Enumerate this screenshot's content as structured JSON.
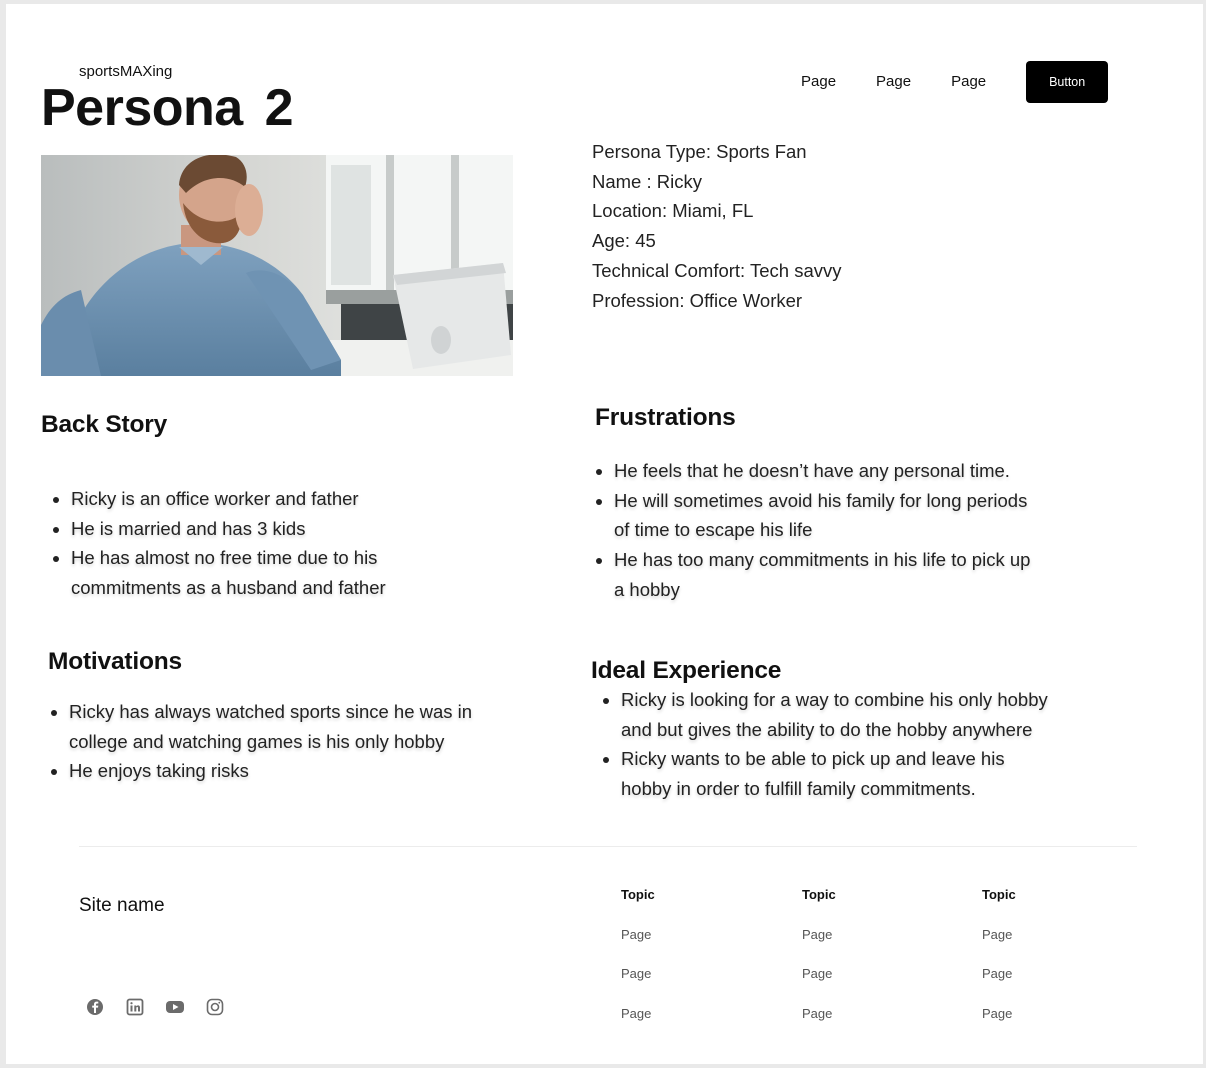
{
  "header": {
    "brand": "sportsMAXing",
    "title": "Persona 2",
    "nav": [
      "Page",
      "Page",
      "Page"
    ],
    "button_label": "Button"
  },
  "persona_info": [
    "Persona Type: Sports Fan",
    "Name : Ricky",
    "Location: Miami, FL",
    "Age: 45",
    "Technical Comfort: Tech savvy",
    "Profession: Office Worker"
  ],
  "back_story": {
    "heading": "Back Story",
    "items": [
      "Ricky is an office worker and father",
      "He is married and has 3 kids",
      "He has almost no free time due to his commitments as a husband and father"
    ]
  },
  "motivations": {
    "heading": "Motivations",
    "items": [
      "Ricky has always watched sports since he was in college and watching games is his only hobby",
      "He enjoys taking risks"
    ]
  },
  "frustrations": {
    "heading": "Frustrations",
    "items": [
      "He feels that he doesn’t have any personal time.",
      "He will sometimes avoid his family for long periods of time to escape his life",
      "He has too many commitments in his life to pick up a hobby"
    ]
  },
  "ideal_experience": {
    "heading": "Ideal Experience",
    "items": [
      "Ricky is looking for a way to combine his only hobby and but gives the ability to do the hobby anywhere",
      "Ricky wants to be able to pick up and leave his hobby in order to fulfill family commitments."
    ]
  },
  "footer": {
    "site_name": "Site name",
    "social_icons": [
      "facebook-icon",
      "linkedin-icon",
      "youtube-icon",
      "instagram-icon"
    ],
    "columns": [
      {
        "topic": "Topic",
        "pages": [
          "Page",
          "Page",
          "Page"
        ]
      },
      {
        "topic": "Topic",
        "pages": [
          "Page",
          "Page",
          "Page"
        ]
      },
      {
        "topic": "Topic",
        "pages": [
          "Page",
          "Page",
          "Page"
        ]
      }
    ]
  }
}
